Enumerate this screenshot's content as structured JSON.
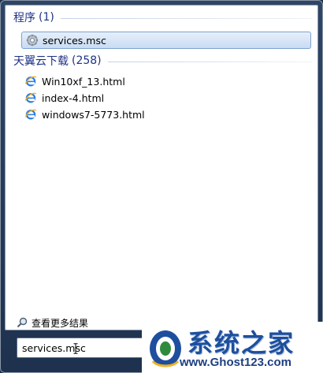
{
  "groups": [
    {
      "title": "程序",
      "count": "(1)",
      "items": [
        {
          "label": "services.msc",
          "icon": "services-gear-icon",
          "selected": true
        }
      ]
    },
    {
      "title": "天翼云下载",
      "count": "(258)",
      "items": [
        {
          "label": "Win10xf_13.html",
          "icon": "ie-html-icon"
        },
        {
          "label": "index-4.html",
          "icon": "ie-html-icon"
        },
        {
          "label": "windows7-5773.html",
          "icon": "ie-html-icon"
        }
      ]
    }
  ],
  "see_more": {
    "label": "查看更多结果",
    "icon": "magnifier-icon"
  },
  "search": {
    "value": "services.msc"
  },
  "watermark": {
    "title": "系统之家",
    "url": "www.Ghost123.com",
    "icon": "ghost-logo-icon"
  },
  "colors": {
    "group_title": "#1e3287",
    "selection_top": "#e6f0fa",
    "selection_bottom": "#c9dcf2",
    "selection_border": "#7da2ce",
    "panel": "#1e324f",
    "watermark_text": "#1e4f9e"
  }
}
